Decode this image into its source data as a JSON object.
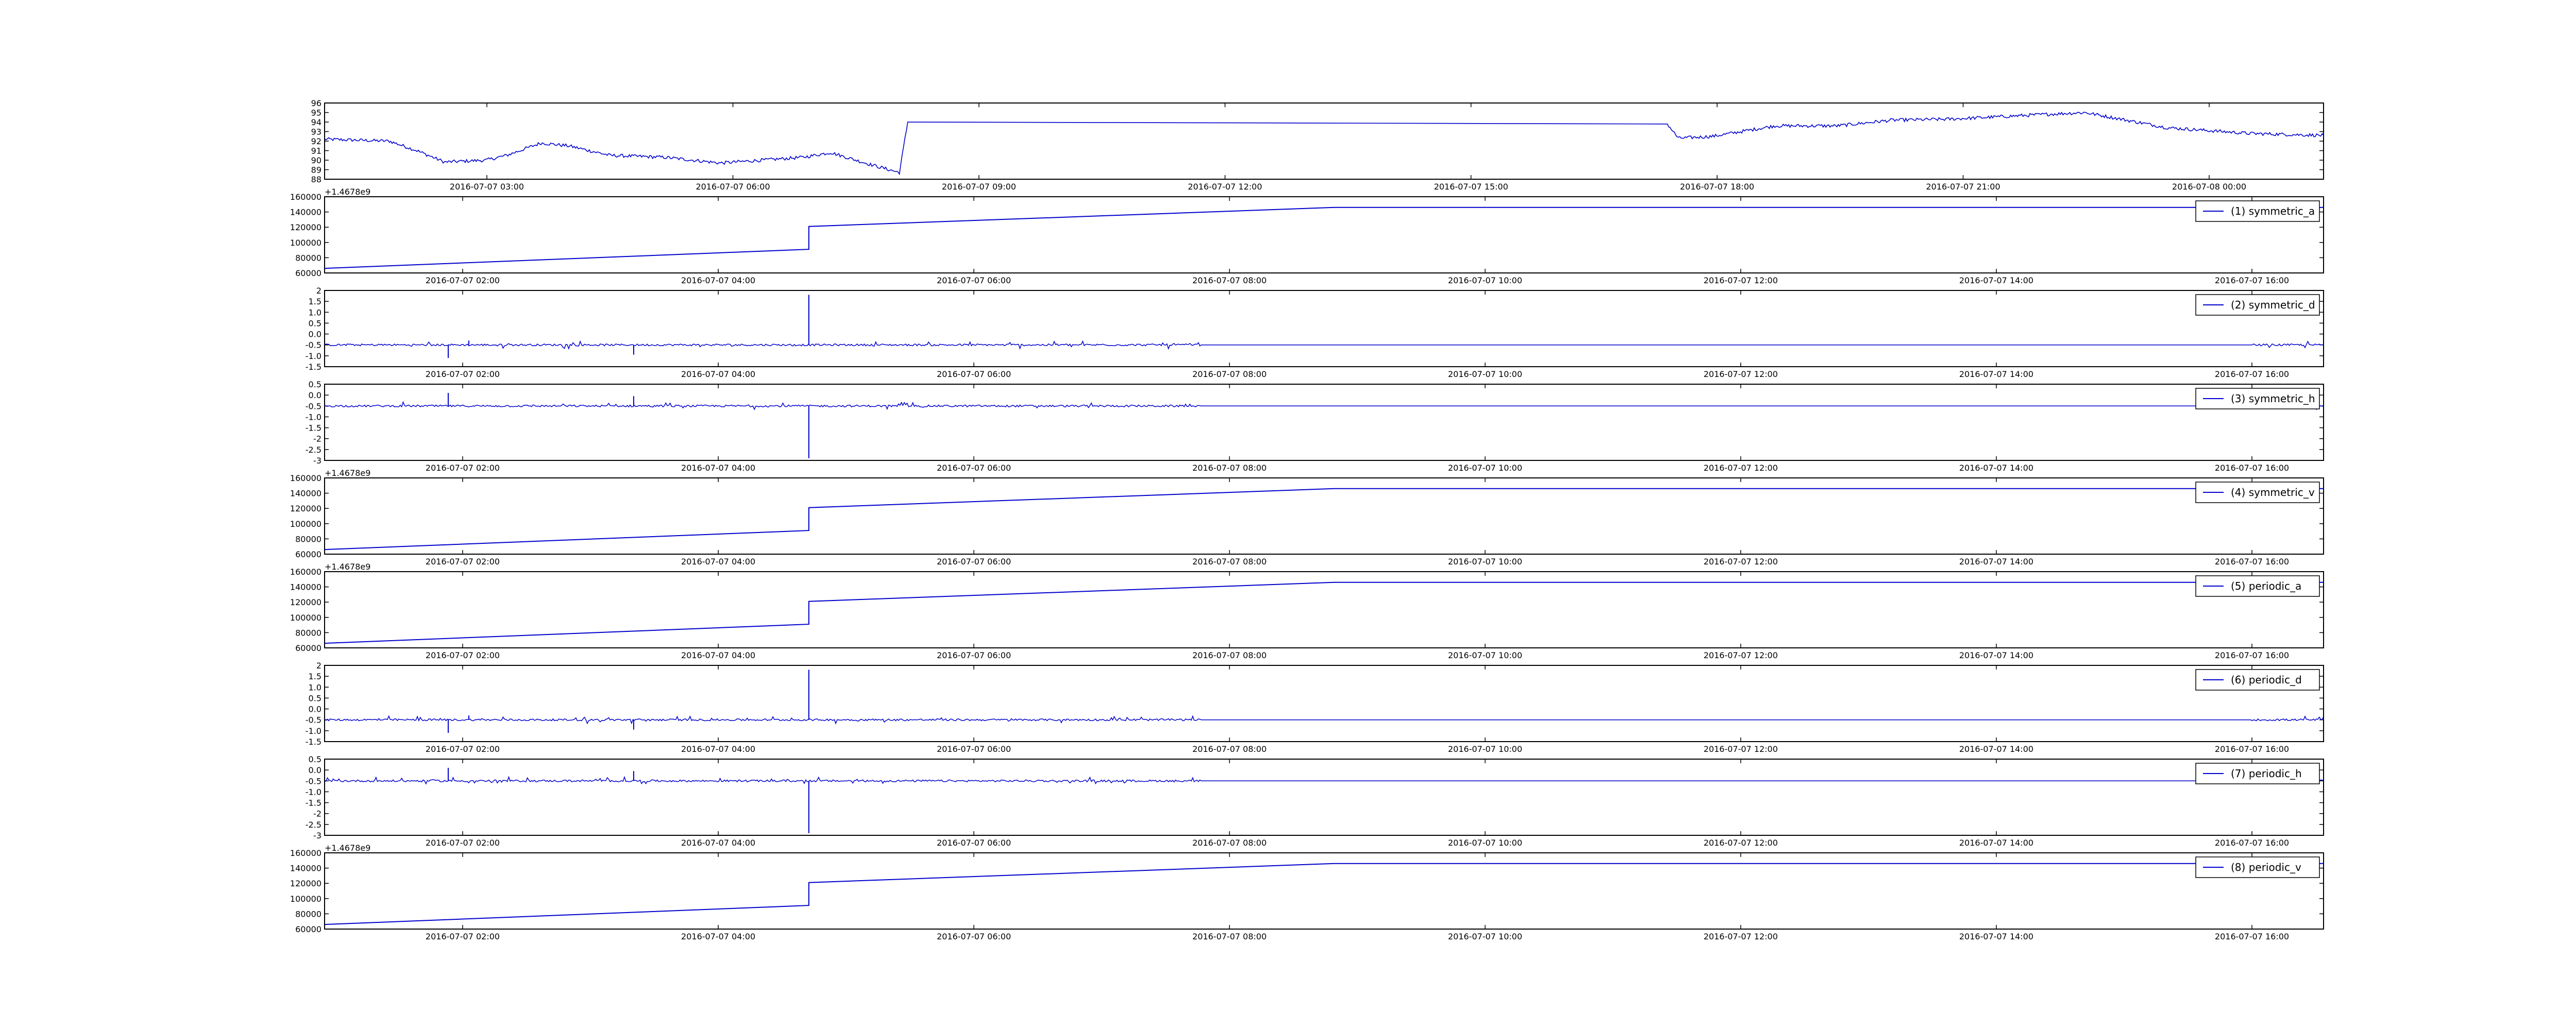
{
  "figure": {
    "background": "#ffffff",
    "axis_color": "#000000"
  },
  "chart_data": [
    {
      "type": "line",
      "panel": "top",
      "color": "#0000cc",
      "x_tick_labels": [
        "2016-07-07 03:00",
        "2016-07-07 06:00",
        "2016-07-07 09:00",
        "2016-07-07 12:00",
        "2016-07-07 15:00",
        "2016-07-07 18:00",
        "2016-07-07 21:00",
        "2016-07-08 00:00"
      ],
      "y_ticks": [
        88,
        89,
        90,
        91,
        92,
        93,
        94,
        95,
        96
      ],
      "ylim": [
        88,
        96
      ],
      "xlim": [
        "2016-07-07 00:43",
        "2016-07-08 00:53"
      ],
      "series": [
        {
          "x": [
            "2016-07-07 00:43",
            "2016-07-07 01:30",
            "2016-07-07 01:50",
            "2016-07-07 02:10",
            "2016-07-07 02:40",
            "2016-07-07 02:55",
            "2016-07-07 03:20",
            "2016-07-07 03:40",
            "2016-07-07 04:10",
            "2016-07-07 04:50",
            "2016-07-07 05:30",
            "2016-07-07 06:00",
            "2016-07-07 06:30",
            "2016-07-07 06:50",
            "2016-07-07 07:20",
            "2016-07-07 07:40",
            "2016-07-07 07:46",
            "2016-07-07 16:57",
            "2016-07-07 17:05",
            "2016-07-07 17:30",
            "2016-07-07 18:15",
            "2016-07-07 19:00",
            "2016-07-07 19:40",
            "2016-07-07 20:20",
            "2016-07-07 20:50",
            "2016-07-07 21:30",
            "2016-07-07 22:00",
            "2016-07-07 23:00",
            "2016-07-08 00:00",
            "2016-07-08 00:53"
          ],
          "y": [
            92.2,
            92,
            91,
            89.8,
            90,
            90.5,
            91.8,
            91.5,
            90.5,
            90.3,
            89.7,
            90,
            90.3,
            90.8,
            89.5,
            88.7,
            94,
            93.8,
            92.3,
            92.5,
            93.6,
            93.6,
            94.2,
            94.3,
            94.5,
            94.8,
            95,
            93.4,
            92.8,
            92.6
          ]
        }
      ]
    },
    {
      "type": "line",
      "panel": "symmetric_a",
      "offset_label": "+1.4678e9",
      "legend": "(1) symmetric_a",
      "legend_position": "top-right",
      "color": "#0000cc",
      "x_tick_labels": [
        "2016-07-07 02:00",
        "2016-07-07 04:00",
        "2016-07-07 06:00",
        "2016-07-07 08:00",
        "2016-07-07 10:00",
        "2016-07-07 12:00",
        "2016-07-07 14:00",
        "2016-07-07 16:00"
      ],
      "y_ticks": [
        60000,
        80000,
        100000,
        120000,
        140000,
        160000
      ],
      "ylim": [
        60000,
        160000
      ],
      "xlim": [
        "2016-07-07 00:05",
        "2016-07-07 16:15"
      ],
      "series": [
        {
          "name": "(1) symmetric_a",
          "x": [
            "2016-07-07 00:05",
            "2016-07-07 04:00",
            "2016-07-07 04:00",
            "2016-07-07 08:15",
            "2016-07-07 16:15"
          ],
          "y": [
            66000,
            91000,
            121000,
            146000,
            146000
          ]
        }
      ]
    },
    {
      "type": "line",
      "panel": "symmetric_d",
      "legend": "(2) symmetric_d",
      "legend_position": "top-right",
      "color": "#0000cc",
      "x_tick_labels": [
        "2016-07-07 02:00",
        "2016-07-07 04:00",
        "2016-07-07 06:00",
        "2016-07-07 08:00",
        "2016-07-07 10:00",
        "2016-07-07 12:00",
        "2016-07-07 14:00",
        "2016-07-07 16:00"
      ],
      "y_ticks": [
        -1.5,
        -1.0,
        -0.5,
        0.0,
        0.5,
        1.0,
        1.5,
        2.0
      ],
      "ylim": [
        -1.5,
        2.0
      ],
      "xlim": [
        "2016-07-07 00:05",
        "2016-07-07 16:15"
      ],
      "series": [
        {
          "name": "(2) symmetric_d",
          "baseline": -0.5,
          "noise_ranges": [
            [
              "2016-07-07 00:05",
              "2016-07-07 07:10"
            ],
            [
              "2016-07-07 15:40",
              "2016-07-07 16:15"
            ]
          ],
          "spikes": [
            {
              "x": "2016-07-07 04:00",
              "y": 1.8
            },
            {
              "x": "2016-07-07 01:05",
              "y": -1.1
            },
            {
              "x": "2016-07-07 02:35",
              "y": -0.95
            },
            {
              "x": "2016-07-07 01:15",
              "y": -0.3
            }
          ]
        }
      ]
    },
    {
      "type": "line",
      "panel": "symmetric_h",
      "legend": "(3) symmetric_h",
      "legend_position": "top-right",
      "color": "#0000cc",
      "x_tick_labels": [
        "2016-07-07 02:00",
        "2016-07-07 04:00",
        "2016-07-07 06:00",
        "2016-07-07 08:00",
        "2016-07-07 10:00",
        "2016-07-07 12:00",
        "2016-07-07 14:00",
        "2016-07-07 16:00"
      ],
      "y_ticks": [
        -3.0,
        -2.5,
        -2.0,
        -1.5,
        -1.0,
        -0.5,
        0.0,
        0.5
      ],
      "ylim": [
        -3.0,
        0.5
      ],
      "xlim": [
        "2016-07-07 00:05",
        "2016-07-07 16:15"
      ],
      "series": [
        {
          "name": "(3) symmetric_h",
          "baseline": -0.5,
          "noise_ranges": [
            [
              "2016-07-07 00:05",
              "2016-07-07 07:10"
            ],
            [
              "2016-07-07 15:40",
              "2016-07-07 16:15"
            ]
          ],
          "spikes": [
            {
              "x": "2016-07-07 04:00",
              "y": -2.9
            },
            {
              "x": "2016-07-07 01:05",
              "y": 0.1
            },
            {
              "x": "2016-07-07 02:35",
              "y": -0.05
            }
          ]
        }
      ]
    },
    {
      "type": "line",
      "panel": "symmetric_v",
      "offset_label": "+1.4678e9",
      "legend": "(4) symmetric_v",
      "legend_position": "top-right",
      "color": "#0000cc",
      "x_tick_labels": [
        "2016-07-07 02:00",
        "2016-07-07 04:00",
        "2016-07-07 06:00",
        "2016-07-07 08:00",
        "2016-07-07 10:00",
        "2016-07-07 12:00",
        "2016-07-07 14:00",
        "2016-07-07 16:00"
      ],
      "y_ticks": [
        60000,
        80000,
        100000,
        120000,
        140000,
        160000
      ],
      "ylim": [
        60000,
        160000
      ],
      "xlim": [
        "2016-07-07 00:05",
        "2016-07-07 16:15"
      ],
      "series": [
        {
          "name": "(4) symmetric_v",
          "x": [
            "2016-07-07 00:05",
            "2016-07-07 04:00",
            "2016-07-07 04:00",
            "2016-07-07 08:15",
            "2016-07-07 16:15"
          ],
          "y": [
            66000,
            91000,
            121000,
            146000,
            146000
          ]
        }
      ]
    },
    {
      "type": "line",
      "panel": "periodic_a",
      "offset_label": "+1.4678e9",
      "legend": "(5) periodic_a",
      "legend_position": "top-right",
      "color": "#0000cc",
      "x_tick_labels": [
        "2016-07-07 02:00",
        "2016-07-07 04:00",
        "2016-07-07 06:00",
        "2016-07-07 08:00",
        "2016-07-07 10:00",
        "2016-07-07 12:00",
        "2016-07-07 14:00",
        "2016-07-07 16:00"
      ],
      "y_ticks": [
        60000,
        80000,
        100000,
        120000,
        140000,
        160000
      ],
      "ylim": [
        60000,
        160000
      ],
      "xlim": [
        "2016-07-07 00:05",
        "2016-07-07 16:15"
      ],
      "series": [
        {
          "name": "(5) periodic_a",
          "x": [
            "2016-07-07 00:05",
            "2016-07-07 04:00",
            "2016-07-07 04:00",
            "2016-07-07 08:15",
            "2016-07-07 16:15"
          ],
          "y": [
            66000,
            91000,
            121000,
            146000,
            146000
          ]
        }
      ]
    },
    {
      "type": "line",
      "panel": "periodic_d",
      "legend": "(6) periodic_d",
      "legend_position": "top-right",
      "color": "#0000cc",
      "x_tick_labels": [
        "2016-07-07 02:00",
        "2016-07-07 04:00",
        "2016-07-07 06:00",
        "2016-07-07 08:00",
        "2016-07-07 10:00",
        "2016-07-07 12:00",
        "2016-07-07 14:00",
        "2016-07-07 16:00"
      ],
      "y_ticks": [
        -1.5,
        -1.0,
        -0.5,
        0.0,
        0.5,
        1.0,
        1.5,
        2.0
      ],
      "ylim": [
        -1.5,
        2.0
      ],
      "xlim": [
        "2016-07-07 00:05",
        "2016-07-07 16:15"
      ],
      "series": [
        {
          "name": "(6) periodic_d",
          "baseline": -0.5,
          "noise_ranges": [
            [
              "2016-07-07 00:05",
              "2016-07-07 07:10"
            ],
            [
              "2016-07-07 15:40",
              "2016-07-07 16:15"
            ]
          ],
          "spikes": [
            {
              "x": "2016-07-07 04:00",
              "y": 1.8
            },
            {
              "x": "2016-07-07 01:05",
              "y": -1.1
            },
            {
              "x": "2016-07-07 02:35",
              "y": -0.95
            },
            {
              "x": "2016-07-07 01:15",
              "y": -0.3
            }
          ]
        }
      ]
    },
    {
      "type": "line",
      "panel": "periodic_h",
      "legend": "(7) periodic_h",
      "legend_position": "top-right",
      "color": "#0000cc",
      "x_tick_labels": [
        "2016-07-07 02:00",
        "2016-07-07 04:00",
        "2016-07-07 06:00",
        "2016-07-07 08:00",
        "2016-07-07 10:00",
        "2016-07-07 12:00",
        "2016-07-07 14:00",
        "2016-07-07 16:00"
      ],
      "y_ticks": [
        -3.0,
        -2.5,
        -2.0,
        -1.5,
        -1.0,
        -0.5,
        0.0,
        0.5
      ],
      "ylim": [
        -3.0,
        0.5
      ],
      "xlim": [
        "2016-07-07 00:05",
        "2016-07-07 16:15"
      ],
      "series": [
        {
          "name": "(7) periodic_h",
          "baseline": -0.5,
          "noise_ranges": [
            [
              "2016-07-07 00:05",
              "2016-07-07 07:10"
            ],
            [
              "2016-07-07 15:40",
              "2016-07-07 16:15"
            ]
          ],
          "spikes": [
            {
              "x": "2016-07-07 04:00",
              "y": -2.9
            },
            {
              "x": "2016-07-07 01:05",
              "y": 0.1
            },
            {
              "x": "2016-07-07 02:35",
              "y": -0.05
            }
          ]
        }
      ]
    },
    {
      "type": "line",
      "panel": "periodic_v",
      "offset_label": "+1.4678e9",
      "legend": "(8) periodic_v",
      "legend_position": "top-right",
      "color": "#0000cc",
      "x_tick_labels": [
        "2016-07-07 02:00",
        "2016-07-07 04:00",
        "2016-07-07 06:00",
        "2016-07-07 08:00",
        "2016-07-07 10:00",
        "2016-07-07 12:00",
        "2016-07-07 14:00",
        "2016-07-07 16:00"
      ],
      "y_ticks": [
        60000,
        80000,
        100000,
        120000,
        140000,
        160000
      ],
      "ylim": [
        60000,
        160000
      ],
      "xlim": [
        "2016-07-07 00:05",
        "2016-07-07 16:15"
      ],
      "series": [
        {
          "name": "(8) periodic_v",
          "x": [
            "2016-07-07 00:05",
            "2016-07-07 04:00",
            "2016-07-07 04:00",
            "2016-07-07 08:15",
            "2016-07-07 16:15"
          ],
          "y": [
            66000,
            91000,
            121000,
            146000,
            146000
          ]
        }
      ]
    }
  ]
}
